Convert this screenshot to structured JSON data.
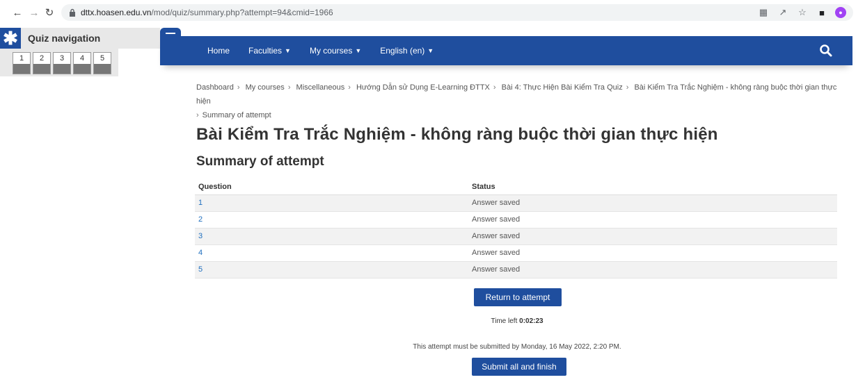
{
  "browser": {
    "url_host": "dttx.hoasen.edu.vn",
    "url_path": "/mod/quiz/summary.php?attempt=94&cmid=1966"
  },
  "quiz_nav": {
    "title": "Quiz navigation",
    "buttons": [
      "1",
      "2",
      "3",
      "4",
      "5"
    ]
  },
  "topnav": {
    "home": "Home",
    "faculties": "Faculties",
    "my_courses": "My courses",
    "language": "English (en)"
  },
  "breadcrumb": [
    "Dashboard",
    "My courses",
    "Miscellaneous",
    "Hướng Dẫn sử Dụng E-Learning ĐTTX",
    "Bài 4: Thực Hiện Bài Kiểm Tra Quiz",
    "Bài Kiểm Tra Trắc Nghiệm - không ràng buộc thời gian thực hiện",
    "Summary of attempt"
  ],
  "page_title": "Bài Kiểm Tra Trắc Nghiệm - không ràng buộc thời gian thực hiện",
  "section_title": "Summary of attempt",
  "table": {
    "headers": [
      "Question",
      "Status"
    ],
    "rows": [
      {
        "question": "1",
        "status": "Answer saved"
      },
      {
        "question": "2",
        "status": "Answer saved"
      },
      {
        "question": "3",
        "status": "Answer saved"
      },
      {
        "question": "4",
        "status": "Answer saved"
      },
      {
        "question": "5",
        "status": "Answer saved"
      }
    ]
  },
  "return_button": "Return to attempt",
  "time_left_label": "Time left",
  "time_left_value": "0:02:23",
  "submit_note": "This attempt must be submitted by Monday, 16 May 2022, 2:20 PM.",
  "submit_button": "Submit all and finish",
  "colors": {
    "primary": "#1f4e9e",
    "link": "#1f6fbf"
  }
}
